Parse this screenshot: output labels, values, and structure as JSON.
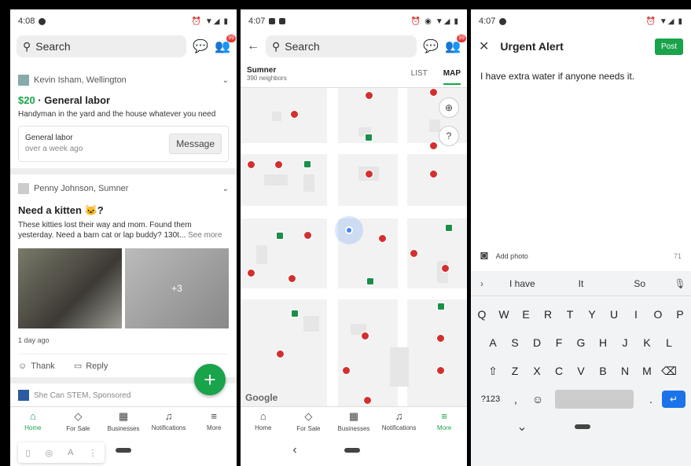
{
  "screen1": {
    "status": {
      "time": "4:08"
    },
    "search": {
      "placeholder": "Search"
    },
    "badge": "99",
    "card1": {
      "author": "Kevin Isham, Wellington",
      "price": "$20",
      "title": " · General labor",
      "desc": "Handyman in the yard and the house whatever you need",
      "sub_title": "General labor",
      "sub_time": "over a week ago",
      "button": "Message"
    },
    "card2": {
      "author": "Penny Johnson, Sumner",
      "title": "Need a kitten 🐱?",
      "desc": "These kitties lost their way and mom. Found them yesterday. Need a barn cat or lap buddy? 130t...",
      "see_more": "See more",
      "more_count": "+3",
      "time": "1 day ago",
      "thank": "Thank",
      "reply": "Reply"
    },
    "sponsored": "She Can STEM, Sponsored",
    "nav": [
      "Home",
      "For Sale",
      "Businesses",
      "Notifications",
      "More"
    ]
  },
  "screen2": {
    "status": {
      "time": "4:07"
    },
    "search": {
      "placeholder": "Search"
    },
    "badge": "99",
    "location": {
      "name": "Sumner",
      "count": "390 neighbors"
    },
    "tabs": [
      "LIST",
      "MAP"
    ],
    "google": "Google",
    "nav": [
      "Home",
      "For Sale",
      "Businesses",
      "Notifications",
      "More"
    ]
  },
  "screen3": {
    "status": {
      "time": "4:07"
    },
    "title": "Urgent Alert",
    "post": "Post",
    "text": "I have extra water if anyone needs it.",
    "add_photo": "Add photo",
    "count": "71",
    "suggestions": [
      "I have",
      "It",
      "So"
    ],
    "rows": [
      [
        "Q",
        "W",
        "E",
        "R",
        "T",
        "Y",
        "U",
        "I",
        "O",
        "P"
      ],
      [
        "A",
        "S",
        "D",
        "F",
        "G",
        "H",
        "J",
        "K",
        "L"
      ],
      [
        "Z",
        "X",
        "C",
        "V",
        "B",
        "N",
        "M"
      ]
    ],
    "sym": "?123",
    "comma": ",",
    "period": "."
  }
}
